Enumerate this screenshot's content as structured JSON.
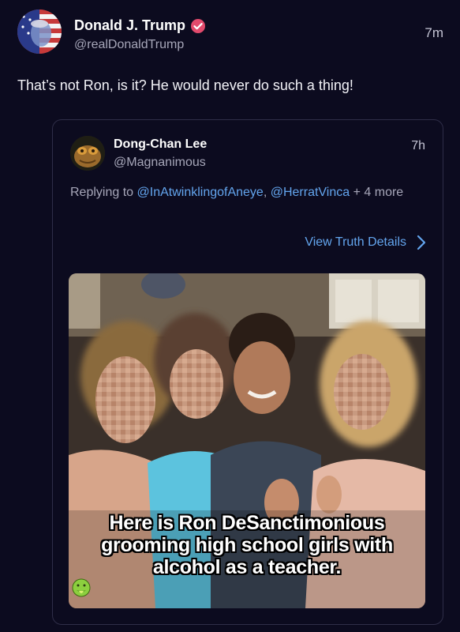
{
  "post": {
    "author_name": "Donald J. Trump",
    "author_handle": "@realDonaldTrump",
    "timestamp": "7m",
    "text": "That’s not Ron, is it? He would never do such a thing!",
    "avatar_icon": "flag-portrait-avatar",
    "verified_icon": "verified-badge-icon",
    "verified_color": "#e24a6c"
  },
  "quote": {
    "author_name": "Dong-Chan Lee",
    "author_handle": "@Magnanimous",
    "timestamp": "7h",
    "replying_prefix": "Replying to ",
    "mention_1": "@InAtwinklingofAneye",
    "separator": ", ",
    "mention_2": "@HerratVinca",
    "more_text": " + 4 more",
    "view_details_label": "View Truth Details",
    "media_caption": {
      "line_1": "Here is Ron DeSanctimonious",
      "line_2": "grooming high school girls with",
      "line_3": "alcohol as a teacher."
    }
  },
  "theme": {
    "background": "#0c0b1f",
    "link_color": "#63a5ee",
    "secondary_text": "#a6a6b8"
  }
}
